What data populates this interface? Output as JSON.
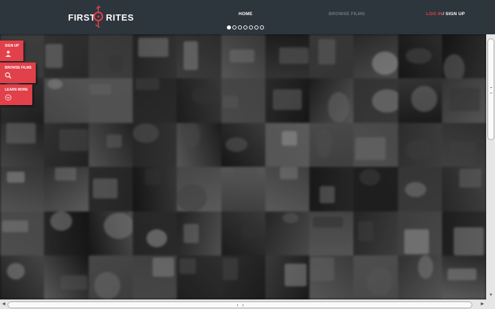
{
  "header": {
    "logo": {
      "first": "FIRST",
      "rites": "RITES"
    },
    "nav": {
      "home": "HOME",
      "browse": "BROWSE FILMS",
      "login": "LOG IN",
      "separator": "/",
      "signup": "SIGN UP"
    },
    "carousel": {
      "dot_count": 7,
      "active_dot": 1
    }
  },
  "side_tabs": {
    "signup": {
      "label": "SIGN UP",
      "icon": "user-icon"
    },
    "browse": {
      "label": "BROWSE FILMS",
      "icon": "search-icon"
    },
    "learn": {
      "label": "LEARN MORE",
      "icon": "chevron-down-circle-icon"
    }
  },
  "background": {
    "description_icon": "poster-mosaic"
  },
  "colors": {
    "header_bg": "#2d353d",
    "accent_red": "#e2404a",
    "nav_inactive": "#707880",
    "text_white": "#ffffff"
  }
}
